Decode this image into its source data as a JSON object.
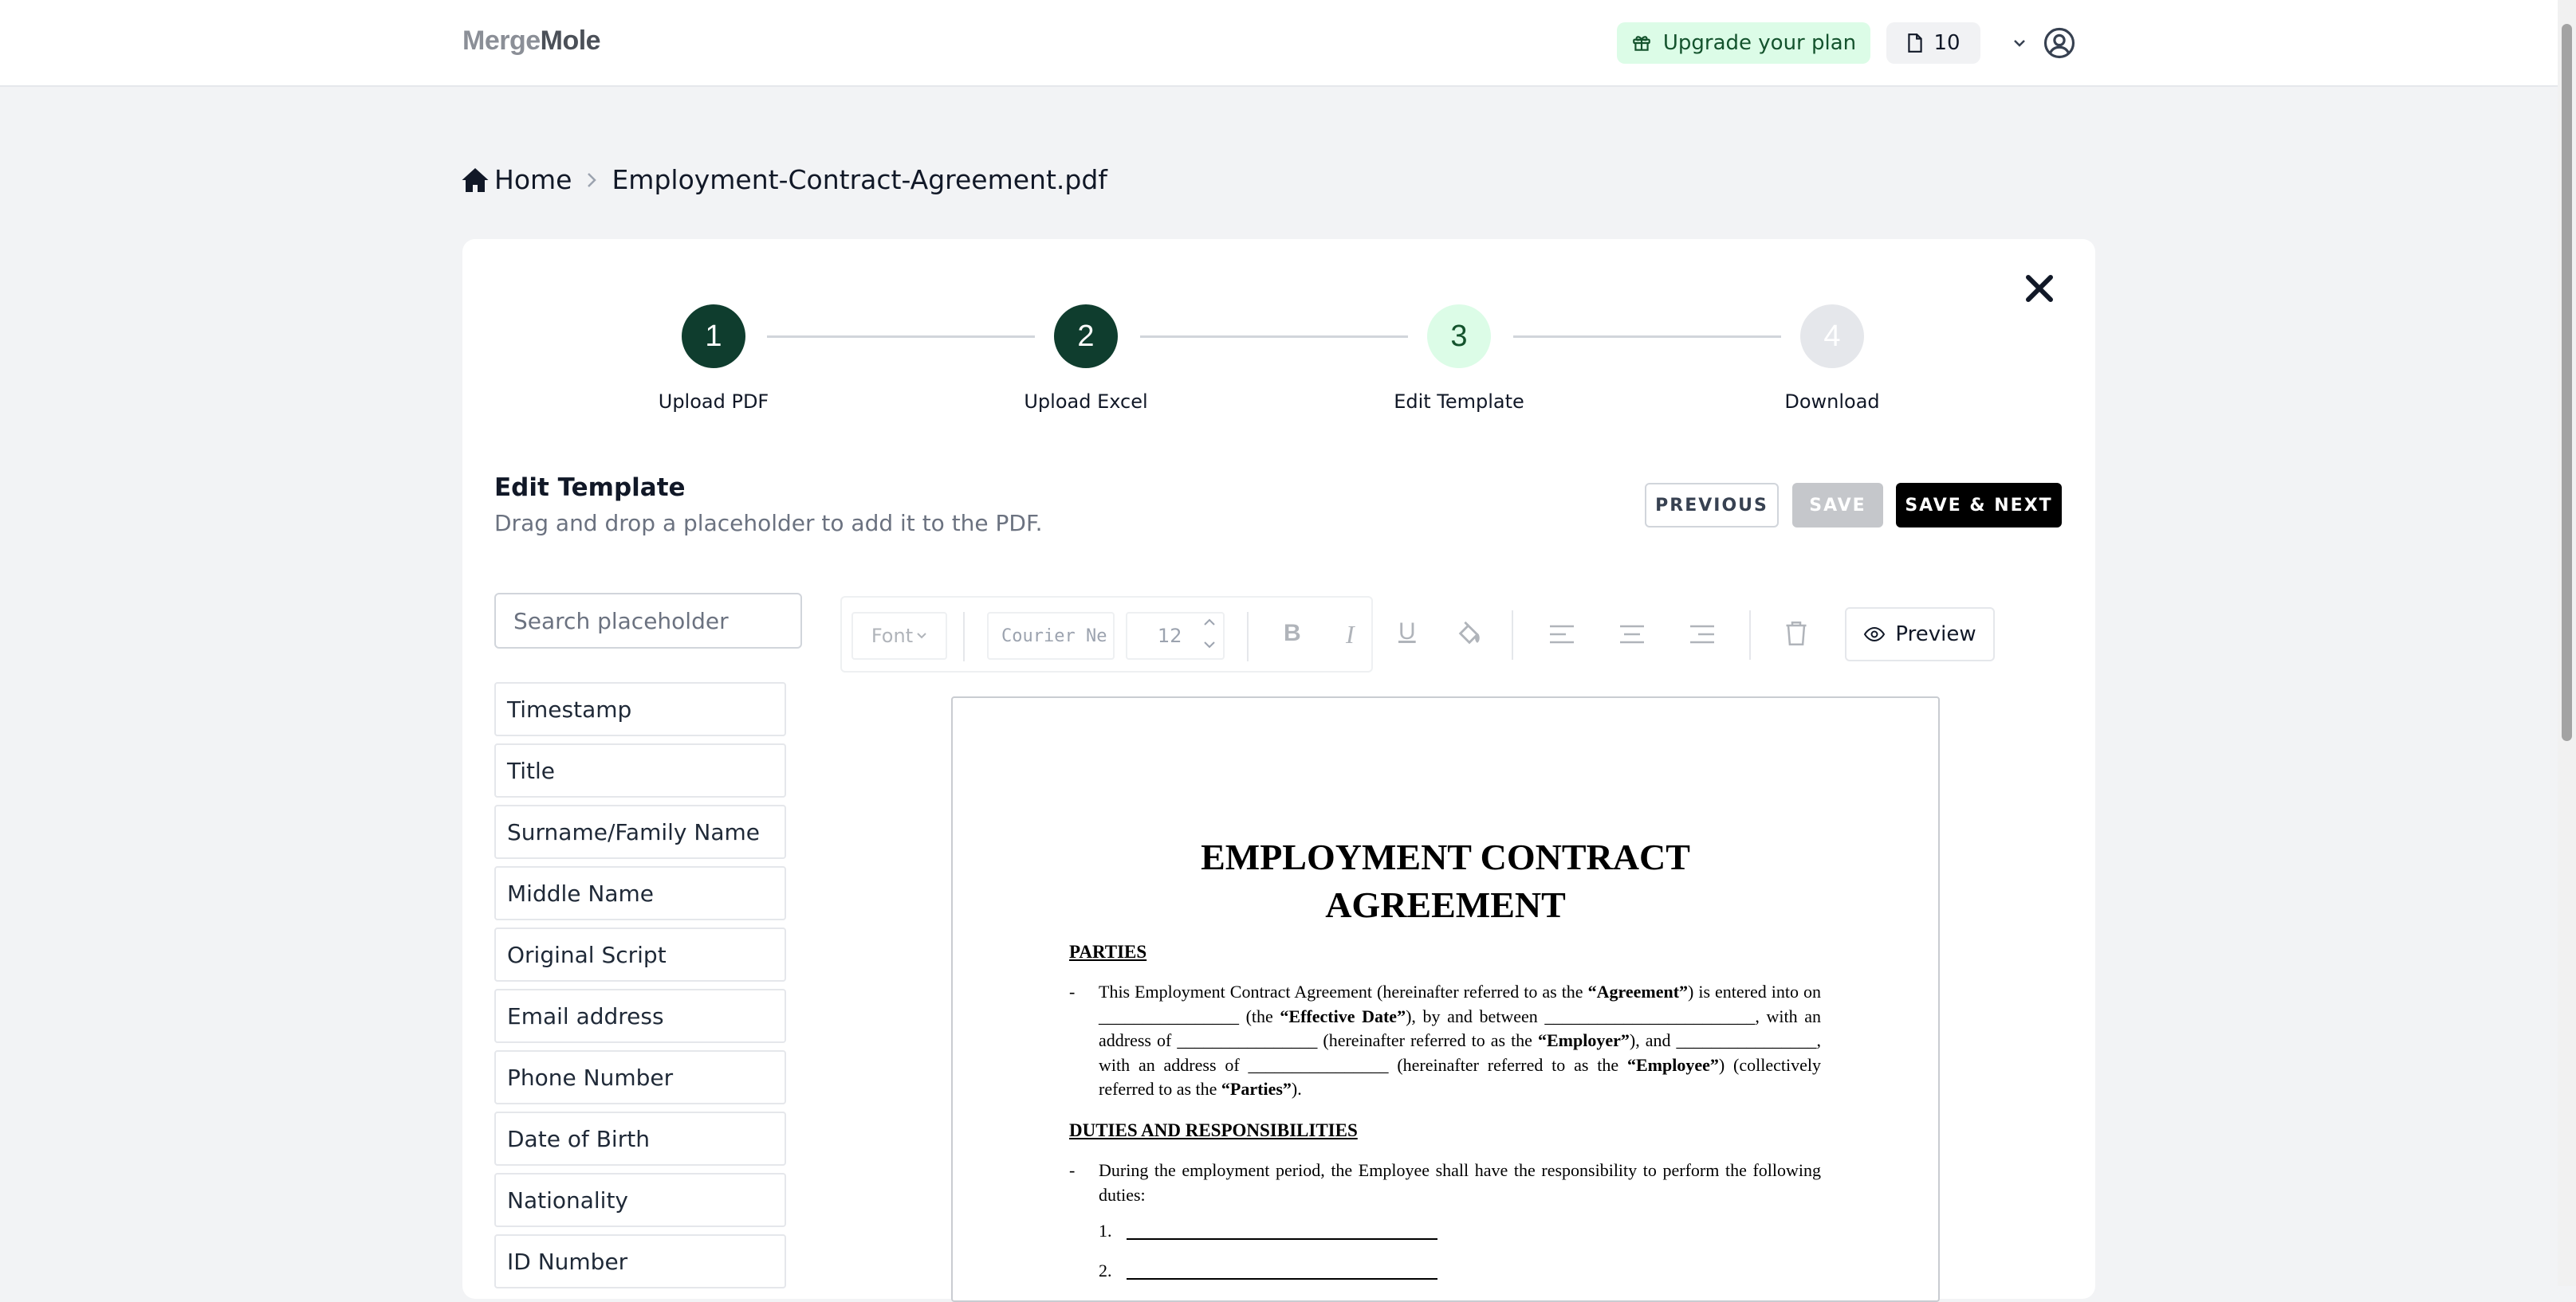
{
  "app": {
    "logo_part1": "Merge",
    "logo_part2": "Mole",
    "upgrade_label": "Upgrade your plan",
    "credits": "10"
  },
  "breadcrumb": {
    "home": "Home",
    "file": "Employment-Contract-Agreement.pdf"
  },
  "stepper": [
    {
      "num": "1",
      "label": "Upload PDF",
      "state": "done"
    },
    {
      "num": "2",
      "label": "Upload Excel",
      "state": "done"
    },
    {
      "num": "3",
      "label": "Edit Template",
      "state": "current"
    },
    {
      "num": "4",
      "label": "Download",
      "state": "pending"
    }
  ],
  "header": {
    "title": "Edit Template",
    "subtitle": "Drag and drop a placeholder to add it to the PDF.",
    "previous": "PREVIOUS",
    "save": "SAVE",
    "save_next": "SAVE & NEXT"
  },
  "search": {
    "placeholder": "Search placeholder"
  },
  "placeholders": [
    "Timestamp",
    "Title",
    "Surname/Family Name",
    "Middle Name",
    "Original Script",
    "Email address",
    "Phone Number",
    "Date of Birth",
    "Nationality",
    "ID Number"
  ],
  "toolbar": {
    "font_label": "Font",
    "font_family_value": "Courier Ne",
    "font_size": "12",
    "preview": "Preview"
  },
  "colors": {
    "step_done": "#0f3d2e",
    "step_current_bg": "#dcfce7",
    "step_pending_bg": "#e5e7eb",
    "upgrade_bg": "#dcfce7"
  },
  "document": {
    "title_line1": "EMPLOYMENT CONTRACT",
    "title_line2": "AGREEMENT",
    "parties_heading": "PARTIES",
    "duties_heading": "DUTIES AND RESPONSIBILITIES",
    "duties_text": "During the employment period, the Employee shall have the responsibility to perform the following duties:",
    "item1": "1.",
    "item2": "2."
  }
}
